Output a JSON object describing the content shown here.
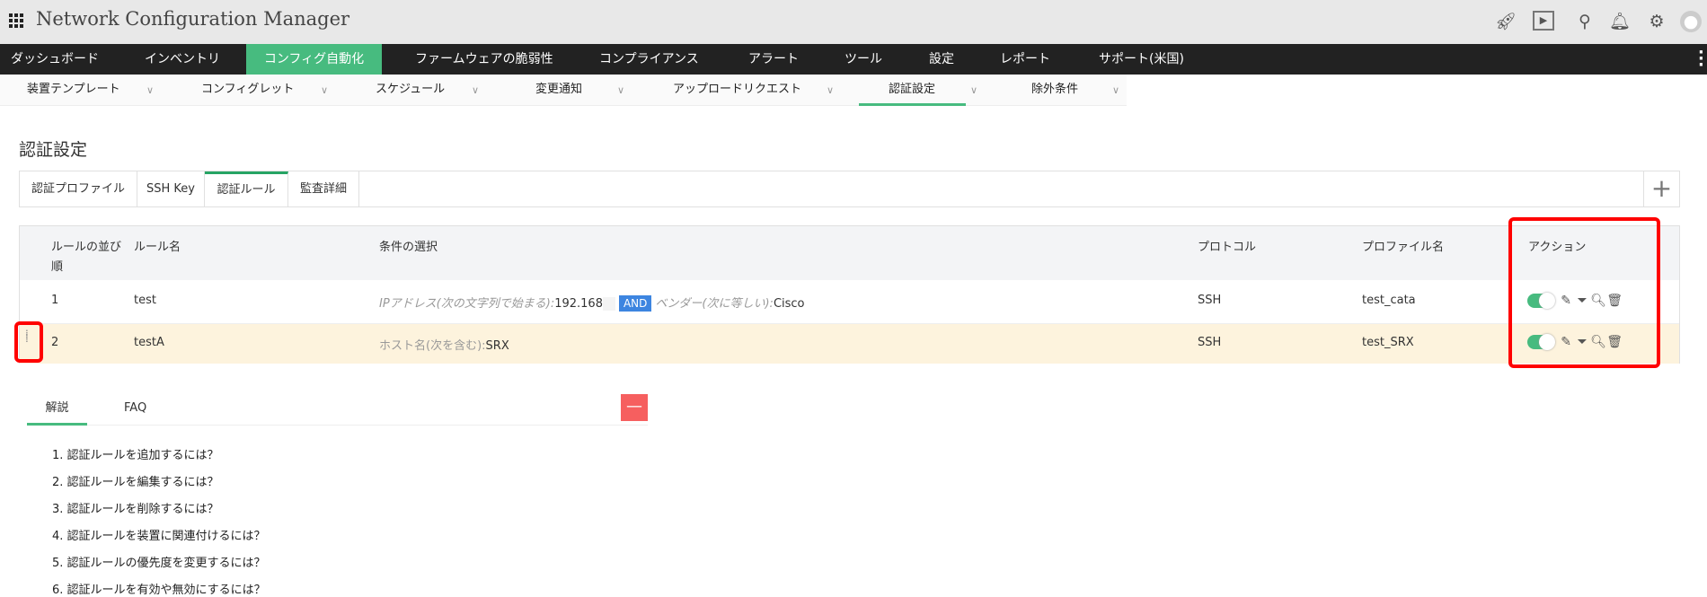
{
  "header": {
    "title": "Network Configuration Manager",
    "icons": [
      "rocket-icon",
      "presentation-icon",
      "search-icon",
      "bell-icon",
      "gear-icon",
      "user-avatar-icon"
    ]
  },
  "nav": {
    "items": [
      "ダッシュボード",
      "インベントリ",
      "コンフィグ自動化",
      "ファームウェアの脆弱性",
      "コンプライアンス",
      "アラート",
      "ツール",
      "設定",
      "レポート",
      "サポート(米国)"
    ],
    "active": "コンフィグ自動化"
  },
  "subnav": {
    "items": [
      "装置テンプレート",
      "コンフィグレット",
      "スケジュール",
      "変更通知",
      "アップロードリクエスト",
      "認証設定",
      "除外条件"
    ],
    "active": "認証設定"
  },
  "page": {
    "title": "認証設定"
  },
  "tabs": {
    "items": [
      "認証プロファイル",
      "SSH Key",
      "認証ルール",
      "監査詳細"
    ],
    "active": "認証ルール",
    "add": "+"
  },
  "table": {
    "headers": {
      "order": "ルールの並び順",
      "name": "ルール名",
      "condition": "条件の選択",
      "protocol": "プロトコル",
      "profile": "プロファイル名",
      "action": "アクション"
    },
    "rows": [
      {
        "order": "1",
        "name": "test",
        "cond1_label": "IPアドレス(次の文字列で始まる):",
        "cond1_value": "192.168",
        "op": "AND",
        "cond2_label": "ベンダー(次に等しい):",
        "cond2_value": "Cisco",
        "protocol": "SSH",
        "profile": "test_cata",
        "enabled": true
      },
      {
        "order": "2",
        "name": "testA",
        "cond1_label": "ホスト名(次を含む):",
        "cond1_value": "SRX",
        "protocol": "SSH",
        "profile": "test_SRX",
        "enabled": true
      }
    ]
  },
  "help": {
    "tabs": [
      "解説",
      "FAQ"
    ],
    "active": "解説",
    "collapse": "—",
    "items": [
      "1. 認証ルールを追加するには？",
      "2. 認証ルールを編集するには？",
      "3. 認証ルールを削除するには？",
      "4. 認証ルールを装置に関連付けるには？",
      "5. 認証ルールの優先度を変更するには？",
      "6. 認証ルールを有効や無効にするには？"
    ]
  },
  "colors": {
    "accent": "#47bb7f",
    "nav_bg": "#222222",
    "highlight_row": "#fdf3dd",
    "and_badge": "#3d85e0",
    "minus": "#f65f5f",
    "annotation": "#ff0000"
  }
}
